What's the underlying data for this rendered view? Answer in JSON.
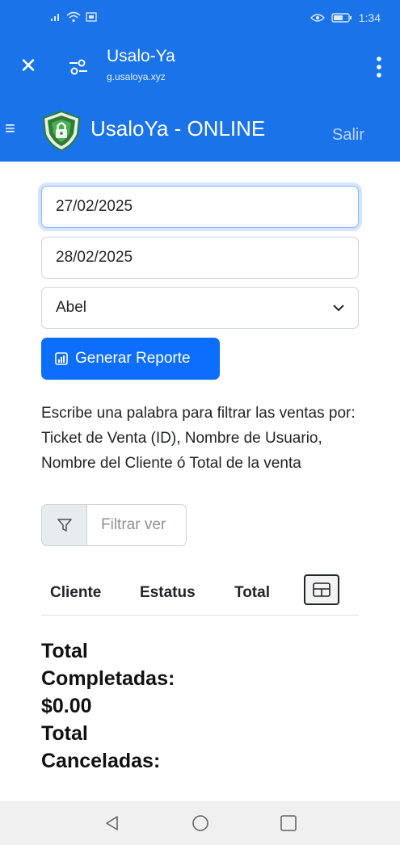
{
  "status_bar": {
    "time": "1:34"
  },
  "browser": {
    "title": "Usalo-Ya",
    "url": "g.usaloya.xyz"
  },
  "navbar": {
    "brand": "UsaloYa - ONLINE",
    "logout": "Salir"
  },
  "form": {
    "start_date": "27/02/2025",
    "end_date": "28/02/2025",
    "user_selected": "Abel",
    "generate_button": "Generar Reporte"
  },
  "filter": {
    "help_text": "Escribe una palabra para filtrar las ventas por: Ticket de Venta (ID), Nombre de Usuario, Nombre del Cliente ó Total de la venta",
    "placeholder": "Filtrar ver"
  },
  "table": {
    "columns": [
      "Cliente",
      "Estatus",
      "Total"
    ]
  },
  "totals": {
    "completed_label_1": "Total",
    "completed_label_2": "Completadas:",
    "completed_value": "$0.00",
    "cancelled_label_1": "Total",
    "cancelled_label_2": "Canceladas:"
  },
  "colors": {
    "brand_blue": "#1a73e8",
    "primary_button": "#0d6efd"
  },
  "icons": [
    "signal-icon",
    "wifi-icon",
    "sim-icon",
    "eye-icon",
    "battery-icon",
    "close-icon",
    "tune-icon",
    "more-vert-icon",
    "menu-icon",
    "shield-lock-logo-icon",
    "chevron-down-icon",
    "bar-chart-icon",
    "filter-icon",
    "columns-icon",
    "back-icon",
    "home-icon",
    "recents-icon"
  ]
}
